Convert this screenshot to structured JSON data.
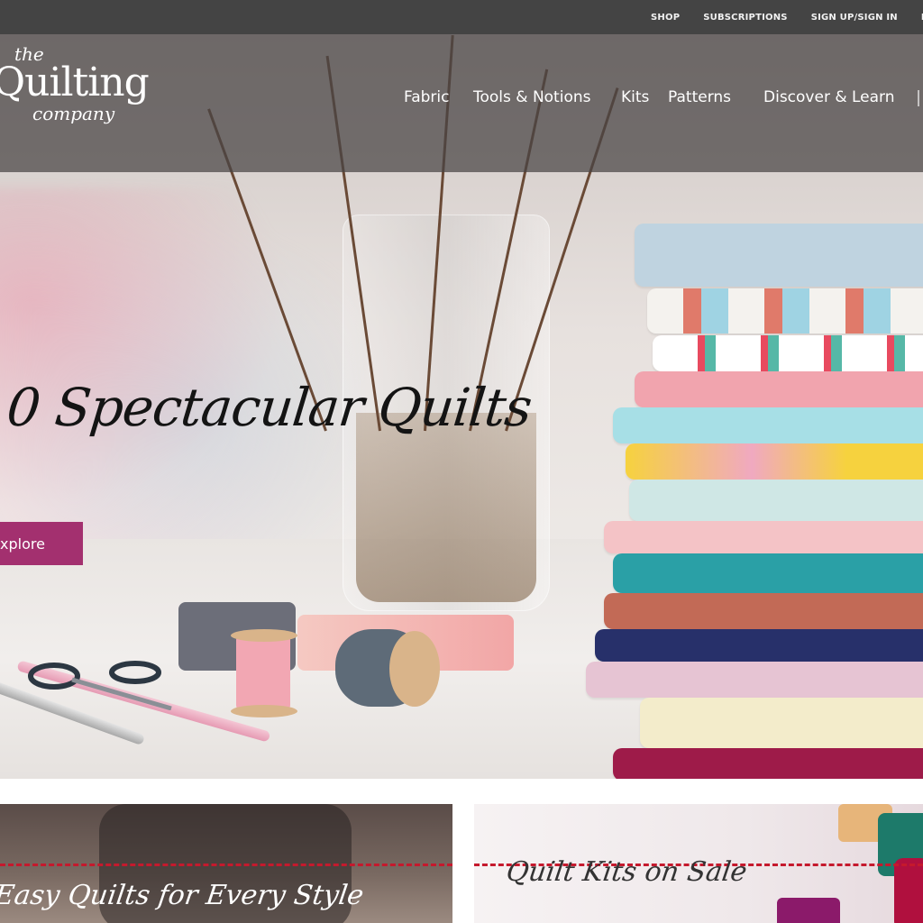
{
  "utility_bar": {
    "links": [
      "SHOP",
      "SUBSCRIPTIONS",
      "SIGN UP/SIGN IN",
      "M"
    ]
  },
  "header": {
    "logo": {
      "the": "the",
      "main": "Quilting",
      "company": "company"
    },
    "nav": [
      "Fabric",
      "Tools & Notions",
      "Kits",
      "Patterns",
      "Discover & Learn"
    ]
  },
  "hero": {
    "title": "0 Spectacular Quilts",
    "button_label": "xplore"
  },
  "promos": {
    "left_title": "Easy Quilts for Every Style",
    "right_title": "Quilt Kits on Sale"
  },
  "colors": {
    "utility_bar": "#444444",
    "header_overlay": "#484444",
    "accent_button": "#a3306f",
    "stitch_line": "#c5192d"
  }
}
